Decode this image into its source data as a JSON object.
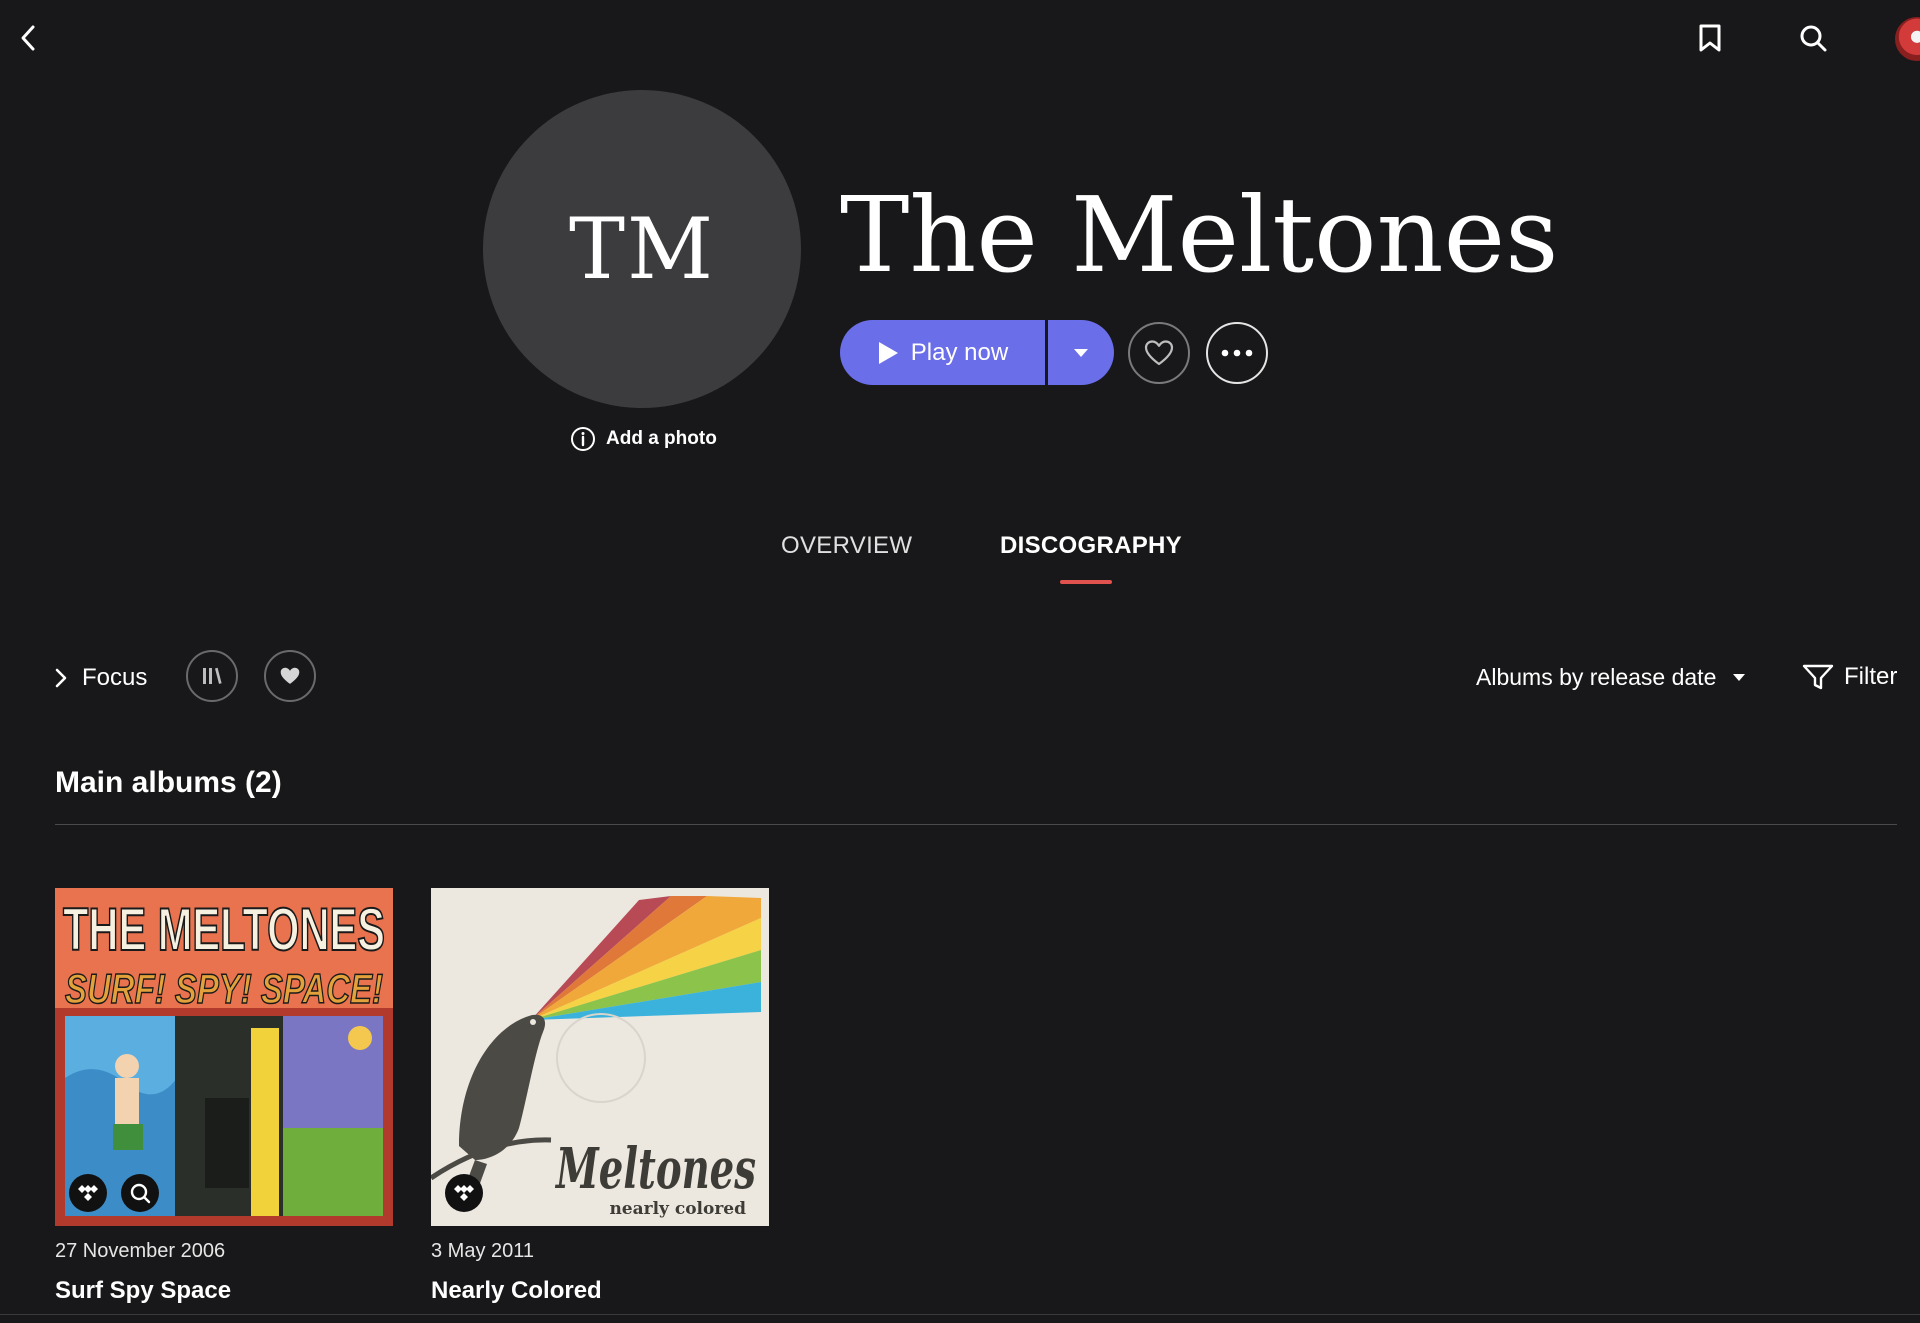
{
  "colors": {
    "background": "#18181a",
    "accent": "#6a6ee8",
    "tab_underline": "#e0524d"
  },
  "header": {
    "initials": "TM",
    "artist_name": "The Meltones",
    "add_photo_label": "Add a photo",
    "play_label": "Play now"
  },
  "tabs": [
    {
      "label": "OVERVIEW",
      "active": false
    },
    {
      "label": "DISCOGRAPHY",
      "active": true
    }
  ],
  "toolbar": {
    "focus_label": "Focus",
    "sort_label": "Albums by release date",
    "filter_label": "Filter"
  },
  "section": {
    "title": "Main albums (2)"
  },
  "albums": [
    {
      "date": "27 November 2006",
      "title": "Surf Spy Space",
      "cover_text_top": "THE MELTONES",
      "cover_text_sub": "SURF! SPY! SPACE!"
    },
    {
      "date": "3 May 2011",
      "title": "Nearly Colored",
      "cover_text_script": "Meltones",
      "cover_text_sub": "nearly colored"
    }
  ],
  "icons": {
    "back": "chevron-left-icon",
    "bookmark": "bookmark-icon",
    "search": "search-icon",
    "avatar": "user-avatar",
    "info": "info-icon",
    "play": "play-icon",
    "caret": "caret-down-icon",
    "heart": "heart-icon",
    "more": "ellipsis-icon",
    "focus": "chevron-right-icon",
    "library": "library-icon",
    "filter": "filter-icon",
    "tidal": "tidal-icon"
  }
}
